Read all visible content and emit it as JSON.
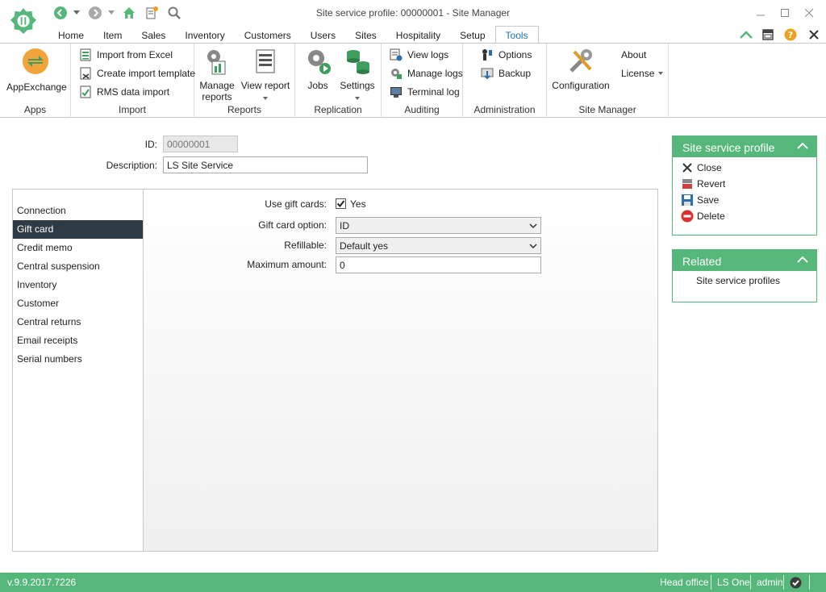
{
  "window": {
    "title": "Site service profile: 00000001 - Site Manager",
    "minimize_icon": "minimize-icon",
    "maximize_icon": "maximize-icon",
    "close_icon": "close-icon"
  },
  "menu_tabs": [
    "Home",
    "Item",
    "Sales",
    "Inventory",
    "Customers",
    "Users",
    "Sites",
    "Hospitality",
    "Setup",
    "Tools"
  ],
  "active_tab": "Tools",
  "ribbon": {
    "apps": {
      "label": "Apps",
      "appexchange": "AppExchange"
    },
    "import": {
      "label": "Import",
      "import_excel": "Import from Excel",
      "create_template": "Create import template",
      "rms_import": "RMS data import"
    },
    "reports": {
      "label": "Reports",
      "manage_line1": "Manage",
      "manage_line2": "reports",
      "view_report": "View report"
    },
    "replication": {
      "label": "Replication",
      "jobs": "Jobs",
      "settings": "Settings"
    },
    "auditing": {
      "label": "Auditing",
      "view_logs": "View logs",
      "manage_logs": "Manage logs",
      "terminal_log": "Terminal log"
    },
    "administration": {
      "label": "Administration",
      "options": "Options",
      "backup": "Backup"
    },
    "site_manager": {
      "label": "Site Manager",
      "configuration": "Configuration",
      "about": "About",
      "license": "License"
    }
  },
  "form": {
    "id_label": "ID:",
    "id_value": "00000001",
    "description_label": "Description:",
    "description_value": "LS Site Service"
  },
  "nav": [
    "Connection",
    "Gift card",
    "Credit  memo",
    "Central suspension",
    "Inventory",
    "Customer",
    "Central returns",
    "Email receipts",
    "Serial numbers"
  ],
  "nav_active": "Gift card",
  "giftcard": {
    "use_label": "Use gift cards:",
    "use_checked": true,
    "use_text": "Yes",
    "option_label": "Gift card option:",
    "option_value": "ID",
    "refillable_label": "Refillable:",
    "refillable_value": "Default yes",
    "max_label": "Maximum amount:",
    "max_value": "0"
  },
  "profile_panel": {
    "title": "Site service profile",
    "actions": [
      "Close",
      "Revert",
      "Save",
      "Delete"
    ]
  },
  "related_panel": {
    "title": "Related",
    "link": "Site service profiles"
  },
  "status": {
    "version": "v.9.9.2017.7226",
    "location": "Head office",
    "product": "LS One",
    "user": "admin"
  },
  "colors": {
    "accent": "#55b87a",
    "tab_active": "#1e6fb0",
    "nav_active": "#2f3b44"
  }
}
